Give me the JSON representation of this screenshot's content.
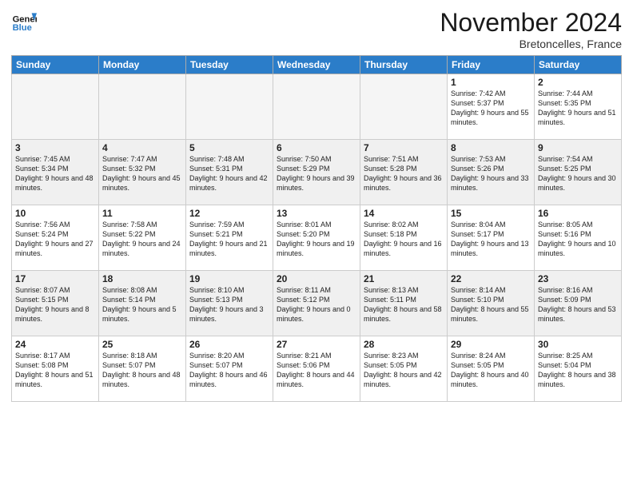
{
  "header": {
    "logo_line1": "General",
    "logo_line2": "Blue",
    "title": "November 2024",
    "subtitle": "Bretoncelles, France"
  },
  "days_of_week": [
    "Sunday",
    "Monday",
    "Tuesday",
    "Wednesday",
    "Thursday",
    "Friday",
    "Saturday"
  ],
  "weeks": [
    [
      {
        "day": "",
        "info": "",
        "empty": true
      },
      {
        "day": "",
        "info": "",
        "empty": true
      },
      {
        "day": "",
        "info": "",
        "empty": true
      },
      {
        "day": "",
        "info": "",
        "empty": true
      },
      {
        "day": "",
        "info": "",
        "empty": true
      },
      {
        "day": "1",
        "info": "Sunrise: 7:42 AM\nSunset: 5:37 PM\nDaylight: 9 hours and 55 minutes."
      },
      {
        "day": "2",
        "info": "Sunrise: 7:44 AM\nSunset: 5:35 PM\nDaylight: 9 hours and 51 minutes."
      }
    ],
    [
      {
        "day": "3",
        "info": "Sunrise: 7:45 AM\nSunset: 5:34 PM\nDaylight: 9 hours and 48 minutes."
      },
      {
        "day": "4",
        "info": "Sunrise: 7:47 AM\nSunset: 5:32 PM\nDaylight: 9 hours and 45 minutes."
      },
      {
        "day": "5",
        "info": "Sunrise: 7:48 AM\nSunset: 5:31 PM\nDaylight: 9 hours and 42 minutes."
      },
      {
        "day": "6",
        "info": "Sunrise: 7:50 AM\nSunset: 5:29 PM\nDaylight: 9 hours and 39 minutes."
      },
      {
        "day": "7",
        "info": "Sunrise: 7:51 AM\nSunset: 5:28 PM\nDaylight: 9 hours and 36 minutes."
      },
      {
        "day": "8",
        "info": "Sunrise: 7:53 AM\nSunset: 5:26 PM\nDaylight: 9 hours and 33 minutes."
      },
      {
        "day": "9",
        "info": "Sunrise: 7:54 AM\nSunset: 5:25 PM\nDaylight: 9 hours and 30 minutes."
      }
    ],
    [
      {
        "day": "10",
        "info": "Sunrise: 7:56 AM\nSunset: 5:24 PM\nDaylight: 9 hours and 27 minutes."
      },
      {
        "day": "11",
        "info": "Sunrise: 7:58 AM\nSunset: 5:22 PM\nDaylight: 9 hours and 24 minutes."
      },
      {
        "day": "12",
        "info": "Sunrise: 7:59 AM\nSunset: 5:21 PM\nDaylight: 9 hours and 21 minutes."
      },
      {
        "day": "13",
        "info": "Sunrise: 8:01 AM\nSunset: 5:20 PM\nDaylight: 9 hours and 19 minutes."
      },
      {
        "day": "14",
        "info": "Sunrise: 8:02 AM\nSunset: 5:18 PM\nDaylight: 9 hours and 16 minutes."
      },
      {
        "day": "15",
        "info": "Sunrise: 8:04 AM\nSunset: 5:17 PM\nDaylight: 9 hours and 13 minutes."
      },
      {
        "day": "16",
        "info": "Sunrise: 8:05 AM\nSunset: 5:16 PM\nDaylight: 9 hours and 10 minutes."
      }
    ],
    [
      {
        "day": "17",
        "info": "Sunrise: 8:07 AM\nSunset: 5:15 PM\nDaylight: 9 hours and 8 minutes."
      },
      {
        "day": "18",
        "info": "Sunrise: 8:08 AM\nSunset: 5:14 PM\nDaylight: 9 hours and 5 minutes."
      },
      {
        "day": "19",
        "info": "Sunrise: 8:10 AM\nSunset: 5:13 PM\nDaylight: 9 hours and 3 minutes."
      },
      {
        "day": "20",
        "info": "Sunrise: 8:11 AM\nSunset: 5:12 PM\nDaylight: 9 hours and 0 minutes."
      },
      {
        "day": "21",
        "info": "Sunrise: 8:13 AM\nSunset: 5:11 PM\nDaylight: 8 hours and 58 minutes."
      },
      {
        "day": "22",
        "info": "Sunrise: 8:14 AM\nSunset: 5:10 PM\nDaylight: 8 hours and 55 minutes."
      },
      {
        "day": "23",
        "info": "Sunrise: 8:16 AM\nSunset: 5:09 PM\nDaylight: 8 hours and 53 minutes."
      }
    ],
    [
      {
        "day": "24",
        "info": "Sunrise: 8:17 AM\nSunset: 5:08 PM\nDaylight: 8 hours and 51 minutes."
      },
      {
        "day": "25",
        "info": "Sunrise: 8:18 AM\nSunset: 5:07 PM\nDaylight: 8 hours and 48 minutes."
      },
      {
        "day": "26",
        "info": "Sunrise: 8:20 AM\nSunset: 5:07 PM\nDaylight: 8 hours and 46 minutes."
      },
      {
        "day": "27",
        "info": "Sunrise: 8:21 AM\nSunset: 5:06 PM\nDaylight: 8 hours and 44 minutes."
      },
      {
        "day": "28",
        "info": "Sunrise: 8:23 AM\nSunset: 5:05 PM\nDaylight: 8 hours and 42 minutes."
      },
      {
        "day": "29",
        "info": "Sunrise: 8:24 AM\nSunset: 5:05 PM\nDaylight: 8 hours and 40 minutes."
      },
      {
        "day": "30",
        "info": "Sunrise: 8:25 AM\nSunset: 5:04 PM\nDaylight: 8 hours and 38 minutes."
      }
    ]
  ]
}
